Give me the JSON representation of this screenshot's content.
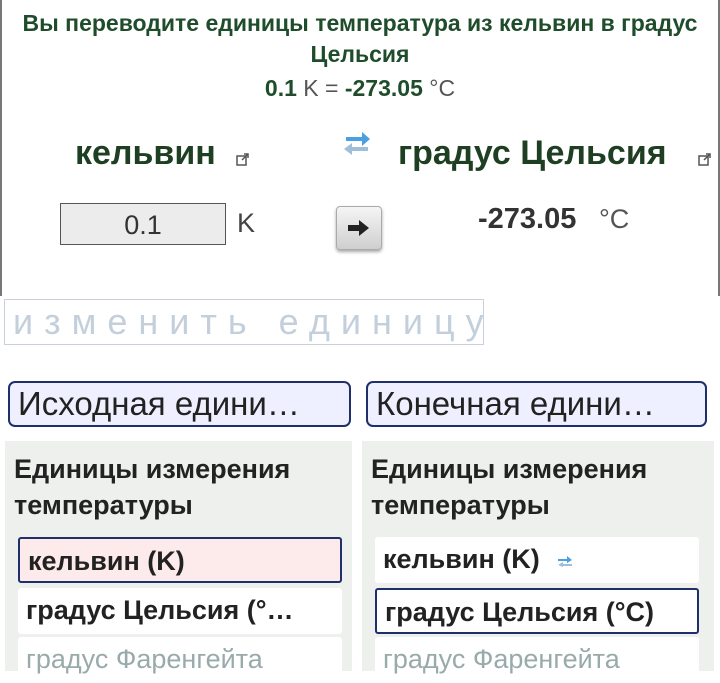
{
  "header": {
    "headline": "Вы переводите единицы температура из кельвин в градус Цельсия",
    "result_from_value": "0.1",
    "result_from_symbol": "K",
    "equals": "=",
    "result_to_value": "-273.05",
    "result_to_symbol": "°C"
  },
  "converter": {
    "from_unit_name": "кельвин",
    "to_unit_name": "градус Цельсия",
    "input_value": "0.1",
    "from_symbol": "K",
    "output_value": "-273.05",
    "to_symbol": "°C",
    "change_units_label": "изменить единицу"
  },
  "pickers": {
    "source_label": "Исходная едини…",
    "target_label": "Конечная едини…"
  },
  "source_panel": {
    "title": "Единицы измерения температуры",
    "items": [
      "кельвин (K)",
      "градус Цельсия (°…",
      "градус Фаренгейта"
    ]
  },
  "target_panel": {
    "title": "Единицы измерения температуры",
    "items": [
      "кельвин (K)",
      "градус Цельсия (°C)",
      "градус Фаренгейта"
    ]
  },
  "colors": {
    "headline_green": "#1f4d2b",
    "selected_border": "#1e2f6b",
    "selected_source_fill": "#fdeaea",
    "panel_background": "#edf0ec"
  },
  "icons": [
    "external-link-icon",
    "swap-arrows-icon",
    "right-arrow-icon"
  ]
}
